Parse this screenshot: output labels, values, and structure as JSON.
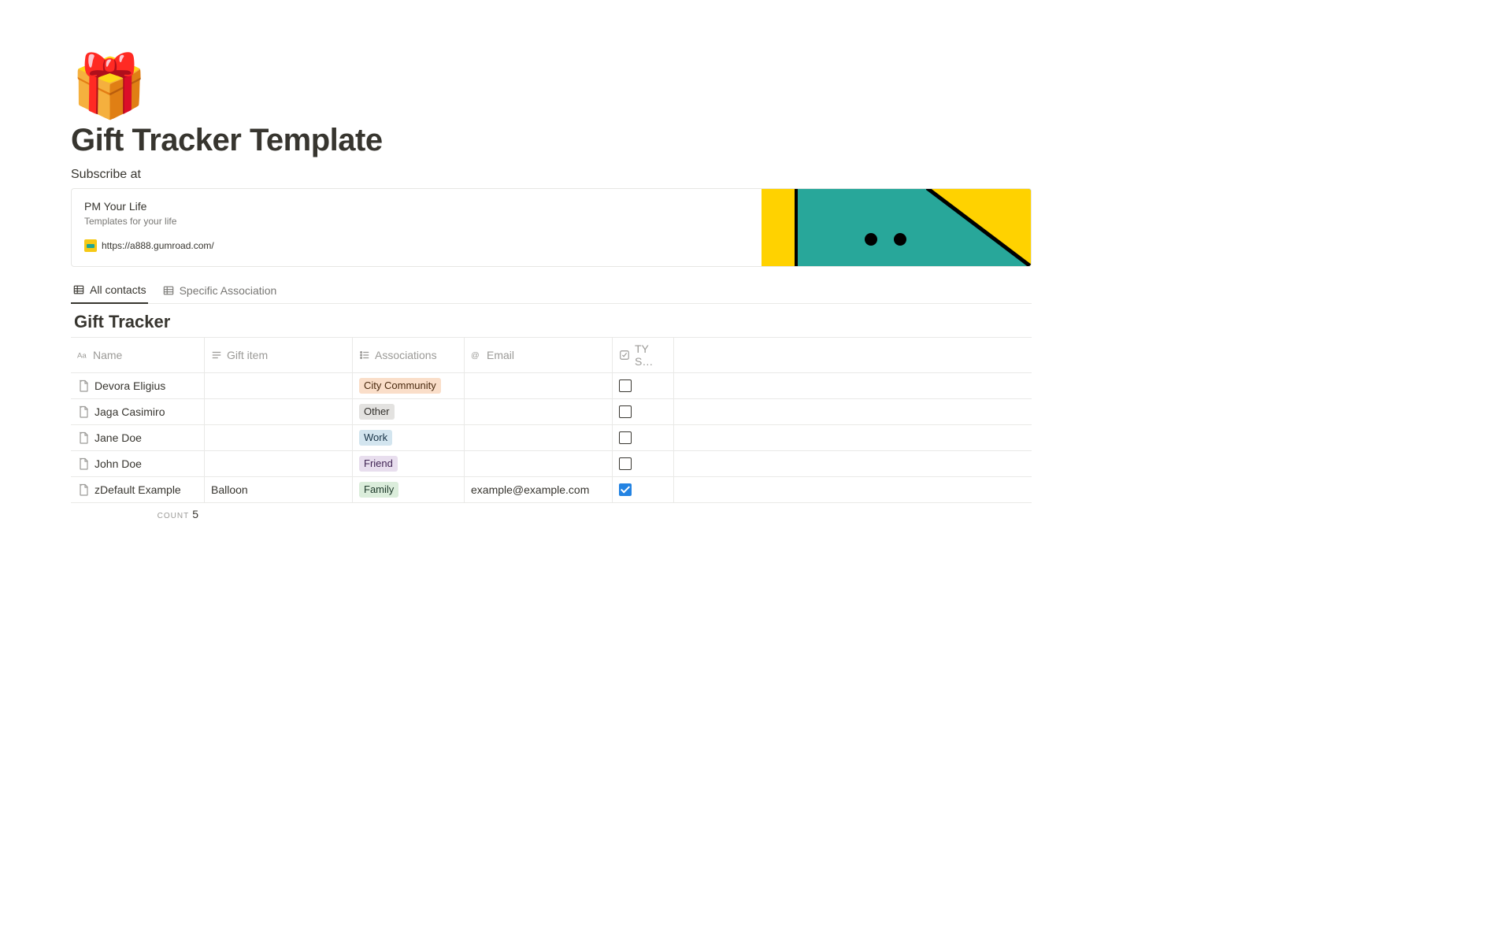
{
  "page": {
    "icon": "🎁",
    "title": "Gift Tracker Template",
    "subtitle": "Subscribe at"
  },
  "bookmark": {
    "title": "PM Your Life",
    "description": "Templates for your life",
    "url": "https://a888.gumroad.com/"
  },
  "tabs": [
    {
      "label": "All contacts",
      "active": true
    },
    {
      "label": "Specific Association",
      "active": false
    }
  ],
  "database": {
    "title": "Gift Tracker",
    "columns": {
      "name": "Name",
      "gift": "Gift item",
      "assoc": "Associations",
      "email": "Email",
      "ty": "TY S…"
    },
    "rows": [
      {
        "name": "Devora Eligius",
        "gift": "",
        "assoc": {
          "label": "City Community",
          "cls": "tag-orange"
        },
        "email": "",
        "ty": false
      },
      {
        "name": "Jaga Casimiro",
        "gift": "",
        "assoc": {
          "label": "Other",
          "cls": "tag-gray"
        },
        "email": "",
        "ty": false
      },
      {
        "name": "Jane Doe",
        "gift": "",
        "assoc": {
          "label": "Work",
          "cls": "tag-blue"
        },
        "email": "",
        "ty": false
      },
      {
        "name": "John Doe",
        "gift": "",
        "assoc": {
          "label": "Friend",
          "cls": "tag-purple"
        },
        "email": "",
        "ty": false
      },
      {
        "name": "zDefault Example",
        "gift": "Balloon",
        "assoc": {
          "label": "Family",
          "cls": "tag-green"
        },
        "email": "example@example.com",
        "ty": true
      }
    ],
    "count_label": "COUNT",
    "count_value": "5"
  }
}
